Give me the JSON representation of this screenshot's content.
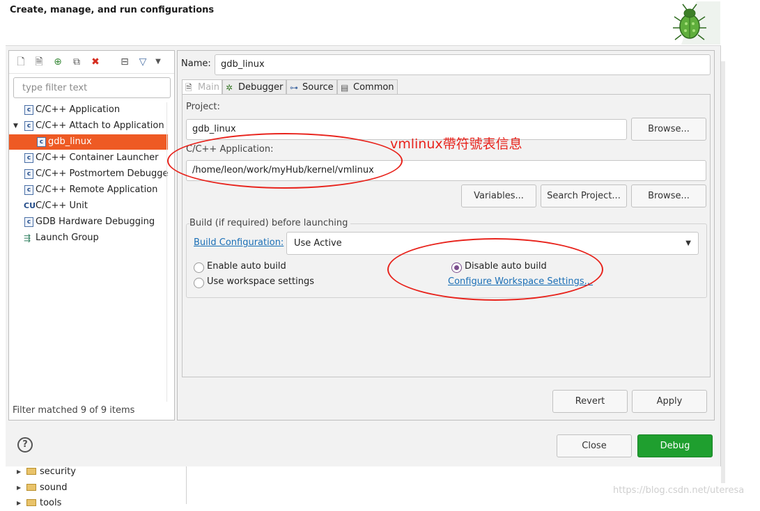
{
  "dialog": {
    "title": "Create, manage, and run configurations"
  },
  "toolbar": {
    "icons": [
      "new-config-icon",
      "duplicate-icon",
      "export-icon",
      "copy-icon",
      "delete-icon",
      "collapse-all-icon",
      "filter-icon",
      "view-menu-icon"
    ]
  },
  "filter": {
    "placeholder": "type filter text",
    "status": "Filter matched 9 of 9 items"
  },
  "tree": {
    "items": [
      {
        "label": "C/C++ Application",
        "icon": "c-app-icon"
      },
      {
        "label": "C/C++ Attach to Application",
        "icon": "c-app-icon",
        "expanded": true
      },
      {
        "label": "gdb_linux",
        "icon": "c-app-icon",
        "selected": true
      },
      {
        "label": "C/C++ Container Launcher",
        "icon": "c-app-icon"
      },
      {
        "label": "C/C++ Postmortem Debugge",
        "icon": "c-app-icon"
      },
      {
        "label": "C/C++ Remote Application",
        "icon": "c-app-icon"
      },
      {
        "label": "C/C++ Unit",
        "icon": "cunit-icon"
      },
      {
        "label": "GDB Hardware Debugging",
        "icon": "c-app-icon"
      },
      {
        "label": "Launch Group",
        "icon": "launch-group-icon"
      }
    ]
  },
  "config": {
    "name_label": "Name:",
    "name_value": "gdb_linux",
    "tabs": [
      {
        "label": "Main",
        "active": true
      },
      {
        "label": "Debugger"
      },
      {
        "label": "Source"
      },
      {
        "label": "Common"
      }
    ],
    "project_label": "Project:",
    "project_value": "gdb_linux",
    "project_browse": "Browse...",
    "app_label": "C/C++ Application:",
    "app_value": "/home/leon/work/myHub/kernel/vmlinux",
    "variables_btn": "Variables...",
    "search_project_btn": "Search Project...",
    "browse_btn": "Browse...",
    "build_group_title": "Build (if required) before launching",
    "build_config_link": "Build Configuration:",
    "build_config_value": "Use Active",
    "radio_enable": "Enable auto build",
    "radio_disable": "Disable auto build",
    "radio_workspace": "Use workspace settings",
    "configure_link": "Configure Workspace Settings...",
    "selected_radio": "Disable auto build",
    "revert_btn": "Revert",
    "apply_btn": "Apply"
  },
  "annotation": {
    "text": "vmlinux帶符號表信息",
    "color": "#e8231c"
  },
  "footer": {
    "close_btn": "Close",
    "debug_btn": "Debug",
    "debug_color": "#1f9f2f"
  },
  "background": {
    "explorer_items": [
      "security",
      "sound",
      "tools"
    ],
    "watermark": "https://blog.csdn.net/uteresa"
  }
}
